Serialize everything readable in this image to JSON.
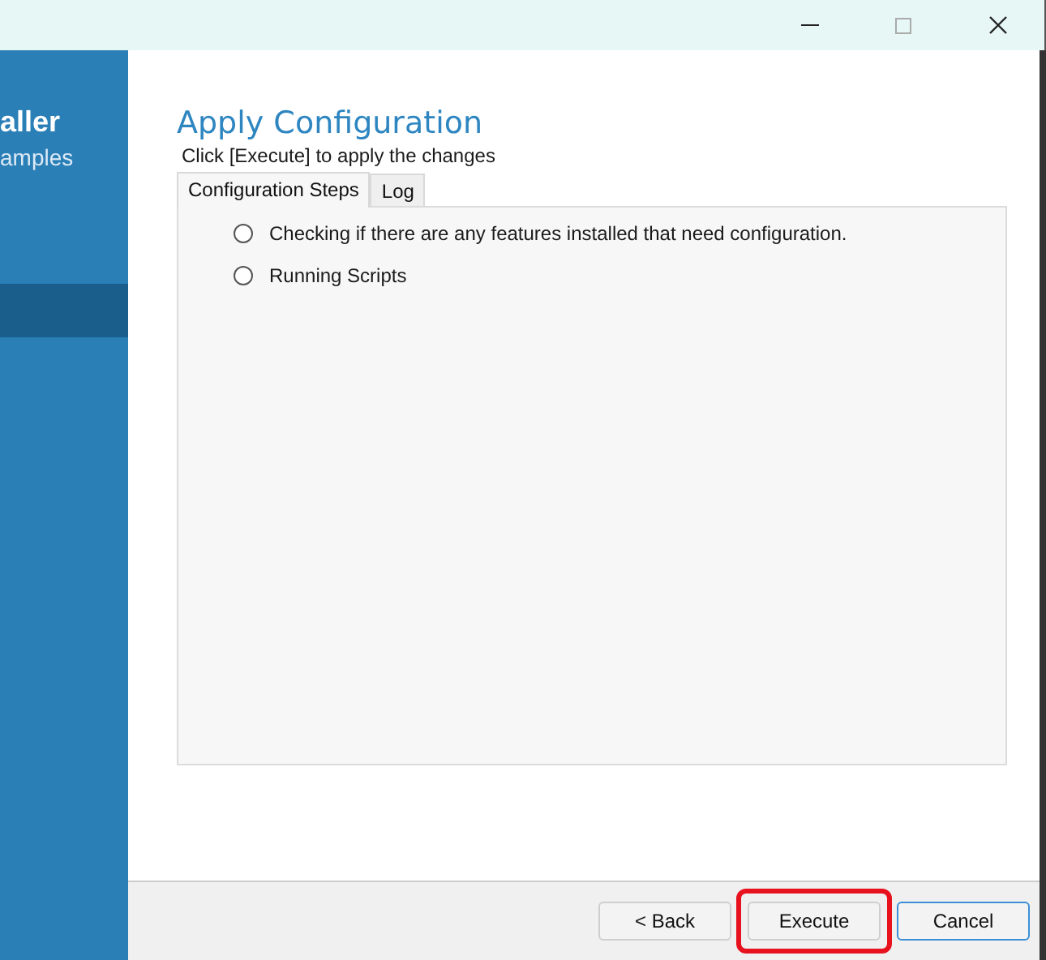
{
  "window": {
    "controls": [
      {
        "kind": "minimize"
      },
      {
        "kind": "maximize"
      },
      {
        "kind": "close"
      }
    ]
  },
  "sidebar": {
    "title": "aller",
    "subtitle": "amples",
    "items": [
      {
        "selected": true
      }
    ]
  },
  "heading": "Apply Configuration",
  "instruction": "Click [Execute] to apply the changes",
  "tabs": [
    {
      "label": "Configuration Steps",
      "selected": true
    },
    {
      "label": "Log",
      "selected": false
    }
  ],
  "steps": [
    {
      "label": "Checking if there are any features installed that need configuration.",
      "checked": false
    },
    {
      "label": "Running Scripts",
      "checked": false
    }
  ],
  "buttons": [
    {
      "label": "< Back",
      "default": false,
      "highlighted": false
    },
    {
      "label": "Execute",
      "default": false,
      "highlighted": true
    },
    {
      "label": "Cancel",
      "default": true,
      "highlighted": false
    }
  ]
}
